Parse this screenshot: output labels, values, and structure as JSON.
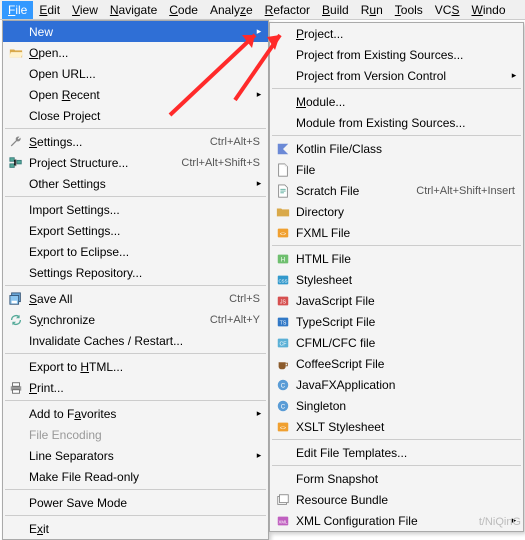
{
  "menubar": {
    "items": [
      {
        "label": "File",
        "active": true
      },
      {
        "label": "Edit"
      },
      {
        "label": "View"
      },
      {
        "label": "Navigate"
      },
      {
        "label": "Code"
      },
      {
        "label": "Analyze"
      },
      {
        "label": "Refactor"
      },
      {
        "label": "Build"
      },
      {
        "label": "Run"
      },
      {
        "label": "Tools"
      },
      {
        "label": "VCS"
      },
      {
        "label": "Windo"
      }
    ]
  },
  "file_menu": {
    "new": "New",
    "open": "Open...",
    "open_url": "Open URL...",
    "open_recent": "Open Recent",
    "close_project": "Close Project",
    "settings": "Settings...",
    "settings_sc": "Ctrl+Alt+S",
    "project_structure": "Project Structure...",
    "project_structure_sc": "Ctrl+Alt+Shift+S",
    "other_settings": "Other Settings",
    "import_settings": "Import Settings...",
    "export_settings": "Export Settings...",
    "export_eclipse": "Export to Eclipse...",
    "settings_repo": "Settings Repository...",
    "save_all": "Save All",
    "save_all_sc": "Ctrl+S",
    "synchronize": "Synchronize",
    "synchronize_sc": "Ctrl+Alt+Y",
    "invalidate": "Invalidate Caches / Restart...",
    "export_html": "Export to HTML...",
    "print": "Print...",
    "add_favorites": "Add to Favorites",
    "file_encoding": "File Encoding",
    "line_separators": "Line Separators",
    "read_only": "Make File Read-only",
    "power_save": "Power Save Mode",
    "exit": "Exit"
  },
  "new_menu": {
    "project": "Project...",
    "project_existing": "Project from Existing Sources...",
    "project_vcs": "Project from Version Control",
    "module": "Module...",
    "module_existing": "Module from Existing Sources...",
    "kotlin": "Kotlin File/Class",
    "file": "File",
    "scratch": "Scratch File",
    "scratch_sc": "Ctrl+Alt+Shift+Insert",
    "directory": "Directory",
    "fxml": "FXML File",
    "html": "HTML File",
    "stylesheet": "Stylesheet",
    "js": "JavaScript File",
    "ts": "TypeScript File",
    "cfml": "CFML/CFC file",
    "coffee": "CoffeeScript File",
    "javafx": "JavaFXApplication",
    "singleton": "Singleton",
    "xslt": "XSLT Stylesheet",
    "edit_templates": "Edit File Templates...",
    "form_snapshot": "Form Snapshot",
    "resource_bundle": "Resource Bundle",
    "xml_config": "XML Configuration File"
  },
  "watermark": "t/NiQinG"
}
